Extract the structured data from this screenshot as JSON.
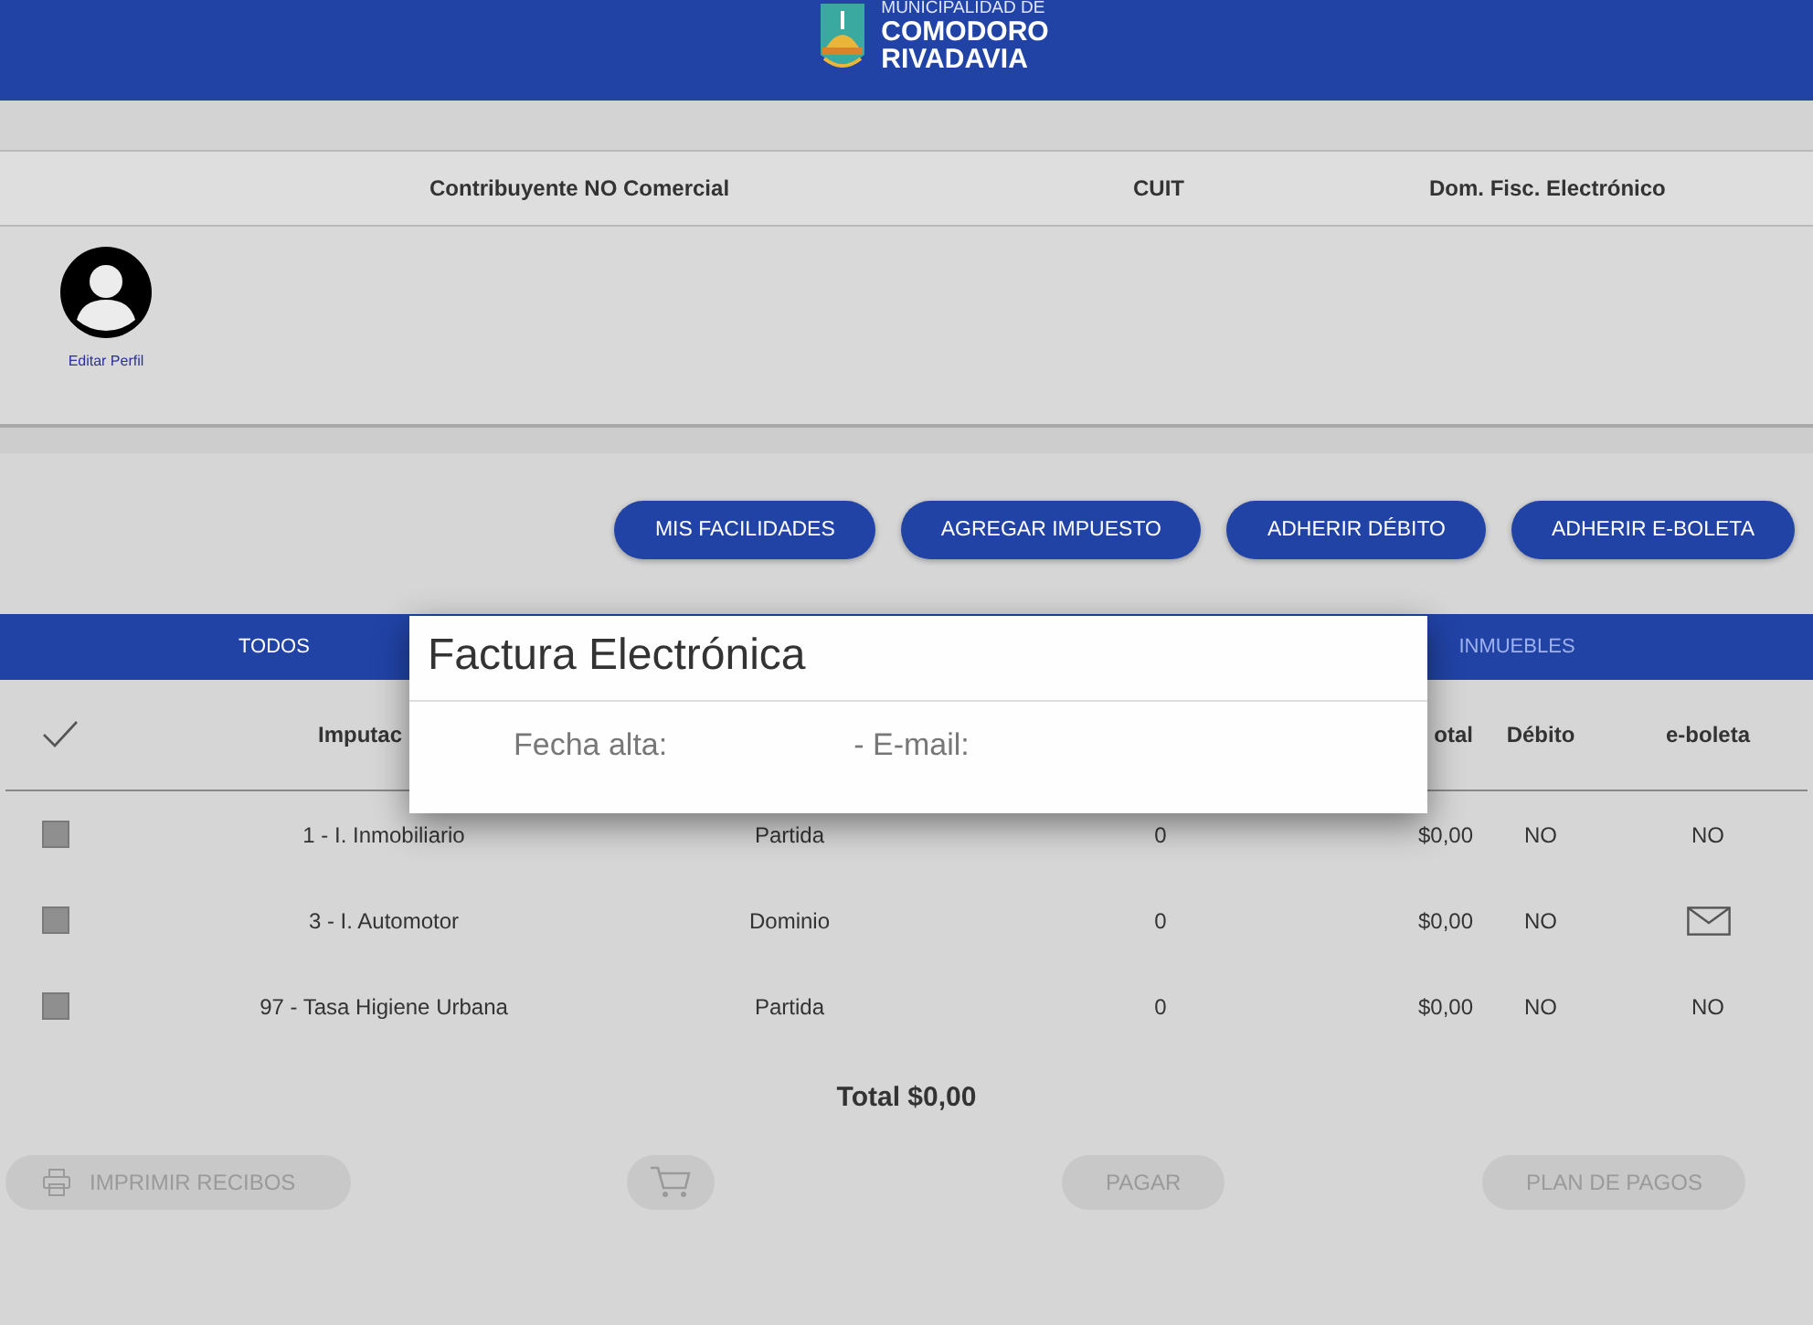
{
  "header": {
    "logo_lines": [
      "MUNICIPALIDAD DE",
      "COMODORO",
      "RIVADAVIA"
    ]
  },
  "info_row": [
    "Contribuyente NO Comercial",
    "CUIT",
    "Dom. Fisc. Electrónico"
  ],
  "profile": {
    "link": "Editar Perfil"
  },
  "actions": [
    "MIS FACILIDADES",
    "AGREGAR IMPUESTO",
    "ADHERIR DÉBITO",
    "ADHERIR E-BOLETA"
  ],
  "tabs": [
    {
      "label": "TODOS",
      "selected": true
    },
    {
      "label": "INMUEBLES",
      "selected": false
    }
  ],
  "table": {
    "columns": [
      "Imputac",
      "otal",
      "Débito",
      "e-boleta"
    ],
    "rows": [
      {
        "checked": false,
        "imputacion": "1 - I. Inmobiliario",
        "tipo": "Partida",
        "valor": "0",
        "total": "$0,00",
        "debito": "NO",
        "e_boleta": {
          "kind": "text",
          "text": "NO"
        }
      },
      {
        "checked": false,
        "imputacion": "3 - I. Automotor",
        "tipo": "Dominio",
        "valor": "0",
        "total": "$0,00",
        "debito": "NO",
        "e_boleta": {
          "kind": "envelope"
        }
      },
      {
        "checked": false,
        "imputacion": "97 - Tasa Higiene Urbana",
        "tipo": "Partida",
        "valor": "0",
        "total": "$0,00",
        "debito": "NO",
        "e_boleta": {
          "kind": "text",
          "text": "NO"
        }
      }
    ]
  },
  "total": "Total $0,00",
  "footer_buttons": [
    {
      "kind": "print",
      "label": "IMPRIMIR RECIBOS",
      "disabled": true
    },
    {
      "kind": "cart",
      "disabled": true
    },
    {
      "kind": "text",
      "label": "PAGAR",
      "disabled": true
    },
    {
      "kind": "text",
      "label": "PLAN DE PAGOS",
      "disabled": true
    }
  ],
  "modal": {
    "title": "Factura Electrónica",
    "fields": [
      "Fecha alta:",
      "- E-mail:"
    ]
  }
}
